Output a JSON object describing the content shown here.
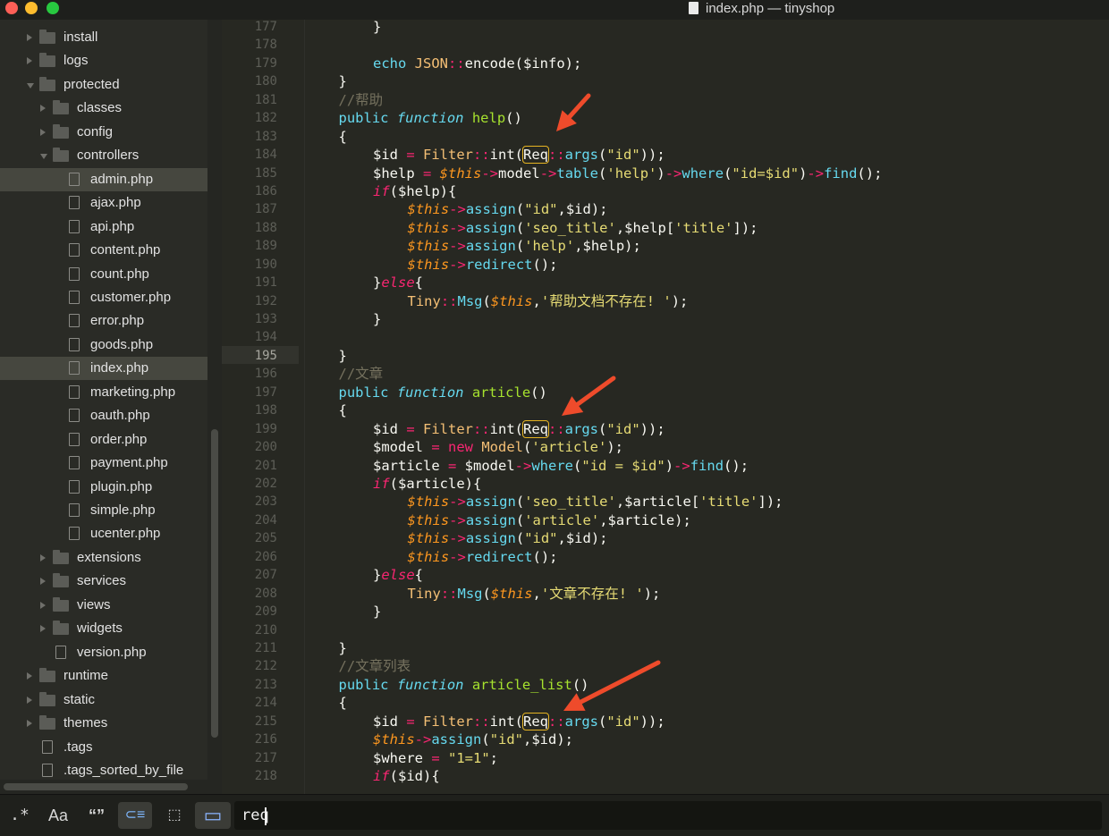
{
  "window": {
    "title": "index.php — tinyshop"
  },
  "sidebar": {
    "items": [
      {
        "label": "install",
        "type": "folder",
        "depth": 0,
        "open": false,
        "selected": false
      },
      {
        "label": "logs",
        "type": "folder",
        "depth": 0,
        "open": false,
        "selected": false
      },
      {
        "label": "protected",
        "type": "folder",
        "depth": 0,
        "open": true,
        "selected": false
      },
      {
        "label": "classes",
        "type": "folder",
        "depth": 1,
        "open": false,
        "selected": false
      },
      {
        "label": "config",
        "type": "folder",
        "depth": 1,
        "open": false,
        "selected": false
      },
      {
        "label": "controllers",
        "type": "folder",
        "depth": 1,
        "open": true,
        "selected": false
      },
      {
        "label": "admin.php",
        "type": "file",
        "depth": 2,
        "selected": true
      },
      {
        "label": "ajax.php",
        "type": "file",
        "depth": 2,
        "selected": false
      },
      {
        "label": "api.php",
        "type": "file",
        "depth": 2,
        "selected": false
      },
      {
        "label": "content.php",
        "type": "file",
        "depth": 2,
        "selected": false
      },
      {
        "label": "count.php",
        "type": "file",
        "depth": 2,
        "selected": false
      },
      {
        "label": "customer.php",
        "type": "file",
        "depth": 2,
        "selected": false
      },
      {
        "label": "error.php",
        "type": "file",
        "depth": 2,
        "selected": false
      },
      {
        "label": "goods.php",
        "type": "file",
        "depth": 2,
        "selected": false
      },
      {
        "label": "index.php",
        "type": "file",
        "depth": 2,
        "selected": true
      },
      {
        "label": "marketing.php",
        "type": "file",
        "depth": 2,
        "selected": false
      },
      {
        "label": "oauth.php",
        "type": "file",
        "depth": 2,
        "selected": false
      },
      {
        "label": "order.php",
        "type": "file",
        "depth": 2,
        "selected": false
      },
      {
        "label": "payment.php",
        "type": "file",
        "depth": 2,
        "selected": false
      },
      {
        "label": "plugin.php",
        "type": "file",
        "depth": 2,
        "selected": false
      },
      {
        "label": "simple.php",
        "type": "file",
        "depth": 2,
        "selected": false
      },
      {
        "label": "ucenter.php",
        "type": "file",
        "depth": 2,
        "selected": false
      },
      {
        "label": "extensions",
        "type": "folder",
        "depth": 1,
        "open": false,
        "selected": false
      },
      {
        "label": "services",
        "type": "folder",
        "depth": 1,
        "open": false,
        "selected": false
      },
      {
        "label": "views",
        "type": "folder",
        "depth": 1,
        "open": false,
        "selected": false
      },
      {
        "label": "widgets",
        "type": "folder",
        "depth": 1,
        "open": false,
        "selected": false
      },
      {
        "label": "version.php",
        "type": "file",
        "depth": 1,
        "selected": false
      },
      {
        "label": "runtime",
        "type": "folder",
        "depth": 0,
        "open": false,
        "selected": false
      },
      {
        "label": "static",
        "type": "folder",
        "depth": 0,
        "open": false,
        "selected": false
      },
      {
        "label": "themes",
        "type": "folder",
        "depth": 0,
        "open": false,
        "selected": false
      },
      {
        "label": ".tags",
        "type": "file",
        "depth": 0,
        "selected": false
      },
      {
        "label": ".tags_sorted_by_file",
        "type": "file",
        "depth": 0,
        "selected": false
      }
    ]
  },
  "editor": {
    "current_line": 195,
    "lines": [
      {
        "n": 177,
        "indent": 2,
        "tokens": [
          [
            "t",
            "}"
          ]
        ]
      },
      {
        "n": 178,
        "indent": 0,
        "tokens": []
      },
      {
        "n": 179,
        "indent": 2,
        "tokens": [
          [
            "k",
            "echo "
          ],
          [
            "y",
            "JSON"
          ],
          [
            "st",
            "::"
          ],
          [
            "t",
            "encode("
          ],
          [
            "t",
            "$info"
          ],
          [
            "t",
            ");"
          ]
        ]
      },
      {
        "n": 180,
        "indent": 1,
        "tokens": [
          [
            "t",
            "}"
          ]
        ]
      },
      {
        "n": 181,
        "indent": 1,
        "tokens": [
          [
            "c",
            "//帮助"
          ]
        ]
      },
      {
        "n": 182,
        "indent": 1,
        "tokens": [
          [
            "k",
            "public "
          ],
          [
            "m",
            "function "
          ],
          [
            "f",
            "help"
          ],
          [
            "t",
            "()"
          ]
        ]
      },
      {
        "n": 183,
        "indent": 1,
        "tokens": [
          [
            "t",
            "{"
          ]
        ]
      },
      {
        "n": 184,
        "indent": 2,
        "tokens": [
          [
            "t",
            "$id "
          ],
          [
            "st",
            "= "
          ],
          [
            "y",
            "Filter"
          ],
          [
            "st",
            "::"
          ],
          [
            "t",
            "int("
          ],
          [
            "hl",
            "Req"
          ],
          [
            "st",
            "::"
          ],
          [
            "k",
            "args"
          ],
          [
            "t",
            "("
          ],
          [
            "s",
            "\"id\""
          ],
          [
            "t",
            "));"
          ]
        ]
      },
      {
        "n": 185,
        "indent": 2,
        "tokens": [
          [
            "t",
            "$help "
          ],
          [
            "st",
            "= "
          ],
          [
            "v",
            "$this"
          ],
          [
            "st",
            "->"
          ],
          [
            "t",
            "model"
          ],
          [
            "st",
            "->"
          ],
          [
            "k",
            "table"
          ],
          [
            "t",
            "("
          ],
          [
            "s",
            "'help'"
          ],
          [
            "t",
            ")"
          ],
          [
            "st",
            "->"
          ],
          [
            "k",
            "where"
          ],
          [
            "t",
            "("
          ],
          [
            "s",
            "\"id=$id\""
          ],
          [
            "t",
            ")"
          ],
          [
            "st",
            "->"
          ],
          [
            "k",
            "find"
          ],
          [
            "t",
            "();"
          ]
        ]
      },
      {
        "n": 186,
        "indent": 2,
        "tokens": [
          [
            "sp",
            "if"
          ],
          [
            "t",
            "($help){"
          ]
        ]
      },
      {
        "n": 187,
        "indent": 3,
        "tokens": [
          [
            "v",
            "$this"
          ],
          [
            "st",
            "->"
          ],
          [
            "k",
            "assign"
          ],
          [
            "t",
            "("
          ],
          [
            "s",
            "\"id\""
          ],
          [
            "t",
            ",$id);"
          ]
        ]
      },
      {
        "n": 188,
        "indent": 3,
        "tokens": [
          [
            "v",
            "$this"
          ],
          [
            "st",
            "->"
          ],
          [
            "k",
            "assign"
          ],
          [
            "t",
            "("
          ],
          [
            "s",
            "'seo_title'"
          ],
          [
            "t",
            ",$help["
          ],
          [
            "s",
            "'title'"
          ],
          [
            "t",
            "]);"
          ]
        ]
      },
      {
        "n": 189,
        "indent": 3,
        "tokens": [
          [
            "v",
            "$this"
          ],
          [
            "st",
            "->"
          ],
          [
            "k",
            "assign"
          ],
          [
            "t",
            "("
          ],
          [
            "s",
            "'help'"
          ],
          [
            "t",
            ",$help);"
          ]
        ]
      },
      {
        "n": 190,
        "indent": 3,
        "tokens": [
          [
            "v",
            "$this"
          ],
          [
            "st",
            "->"
          ],
          [
            "k",
            "redirect"
          ],
          [
            "t",
            "();"
          ]
        ]
      },
      {
        "n": 191,
        "indent": 2,
        "tokens": [
          [
            "t",
            "}"
          ],
          [
            "sp",
            "else"
          ],
          [
            "t",
            "{"
          ]
        ]
      },
      {
        "n": 192,
        "indent": 3,
        "tokens": [
          [
            "y",
            "Tiny"
          ],
          [
            "st",
            "::"
          ],
          [
            "k",
            "Msg"
          ],
          [
            "t",
            "("
          ],
          [
            "v",
            "$this"
          ],
          [
            "t",
            ","
          ],
          [
            "s",
            "'帮助文档不存在! '"
          ],
          [
            "t",
            ");"
          ]
        ]
      },
      {
        "n": 193,
        "indent": 2,
        "tokens": [
          [
            "t",
            "}"
          ]
        ]
      },
      {
        "n": 194,
        "indent": 0,
        "tokens": []
      },
      {
        "n": 195,
        "indent": 1,
        "tokens": [
          [
            "t",
            "}"
          ]
        ]
      },
      {
        "n": 196,
        "indent": 1,
        "tokens": [
          [
            "c",
            "//文章"
          ]
        ]
      },
      {
        "n": 197,
        "indent": 1,
        "tokens": [
          [
            "k",
            "public "
          ],
          [
            "m",
            "function "
          ],
          [
            "f",
            "article"
          ],
          [
            "t",
            "()"
          ]
        ]
      },
      {
        "n": 198,
        "indent": 1,
        "tokens": [
          [
            "t",
            "{"
          ]
        ]
      },
      {
        "n": 199,
        "indent": 2,
        "tokens": [
          [
            "t",
            "$id "
          ],
          [
            "st",
            "= "
          ],
          [
            "y",
            "Filter"
          ],
          [
            "st",
            "::"
          ],
          [
            "t",
            "int("
          ],
          [
            "hl",
            "Req"
          ],
          [
            "st",
            "::"
          ],
          [
            "k",
            "args"
          ],
          [
            "t",
            "("
          ],
          [
            "s",
            "\"id\""
          ],
          [
            "t",
            "));"
          ]
        ]
      },
      {
        "n": 200,
        "indent": 2,
        "tokens": [
          [
            "t",
            "$model "
          ],
          [
            "st",
            "= "
          ],
          [
            "st",
            "new "
          ],
          [
            "y",
            "Model"
          ],
          [
            "t",
            "("
          ],
          [
            "s",
            "'article'"
          ],
          [
            "t",
            ");"
          ]
        ]
      },
      {
        "n": 201,
        "indent": 2,
        "tokens": [
          [
            "t",
            "$article "
          ],
          [
            "st",
            "= "
          ],
          [
            "t",
            "$model"
          ],
          [
            "st",
            "->"
          ],
          [
            "k",
            "where"
          ],
          [
            "t",
            "("
          ],
          [
            "s",
            "\"id = $id\""
          ],
          [
            "t",
            ")"
          ],
          [
            "st",
            "->"
          ],
          [
            "k",
            "find"
          ],
          [
            "t",
            "();"
          ]
        ]
      },
      {
        "n": 202,
        "indent": 2,
        "tokens": [
          [
            "sp",
            "if"
          ],
          [
            "t",
            "($article){"
          ]
        ]
      },
      {
        "n": 203,
        "indent": 3,
        "tokens": [
          [
            "v",
            "$this"
          ],
          [
            "st",
            "->"
          ],
          [
            "k",
            "assign"
          ],
          [
            "t",
            "("
          ],
          [
            "s",
            "'seo_title'"
          ],
          [
            "t",
            ",$article["
          ],
          [
            "s",
            "'title'"
          ],
          [
            "t",
            "]);"
          ]
        ]
      },
      {
        "n": 204,
        "indent": 3,
        "tokens": [
          [
            "v",
            "$this"
          ],
          [
            "st",
            "->"
          ],
          [
            "k",
            "assign"
          ],
          [
            "t",
            "("
          ],
          [
            "s",
            "'article'"
          ],
          [
            "t",
            ",$article);"
          ]
        ]
      },
      {
        "n": 205,
        "indent": 3,
        "tokens": [
          [
            "v",
            "$this"
          ],
          [
            "st",
            "->"
          ],
          [
            "k",
            "assign"
          ],
          [
            "t",
            "("
          ],
          [
            "s",
            "\"id\""
          ],
          [
            "t",
            ",$id);"
          ]
        ]
      },
      {
        "n": 206,
        "indent": 3,
        "tokens": [
          [
            "v",
            "$this"
          ],
          [
            "st",
            "->"
          ],
          [
            "k",
            "redirect"
          ],
          [
            "t",
            "();"
          ]
        ]
      },
      {
        "n": 207,
        "indent": 2,
        "tokens": [
          [
            "t",
            "}"
          ],
          [
            "sp",
            "else"
          ],
          [
            "t",
            "{"
          ]
        ]
      },
      {
        "n": 208,
        "indent": 3,
        "tokens": [
          [
            "y",
            "Tiny"
          ],
          [
            "st",
            "::"
          ],
          [
            "k",
            "Msg"
          ],
          [
            "t",
            "("
          ],
          [
            "v",
            "$this"
          ],
          [
            "t",
            ","
          ],
          [
            "s",
            "'文章不存在! '"
          ],
          [
            "t",
            ");"
          ]
        ]
      },
      {
        "n": 209,
        "indent": 2,
        "tokens": [
          [
            "t",
            "}"
          ]
        ]
      },
      {
        "n": 210,
        "indent": 0,
        "tokens": []
      },
      {
        "n": 211,
        "indent": 1,
        "tokens": [
          [
            "t",
            "}"
          ]
        ]
      },
      {
        "n": 212,
        "indent": 1,
        "tokens": [
          [
            "c",
            "//文章列表"
          ]
        ]
      },
      {
        "n": 213,
        "indent": 1,
        "tokens": [
          [
            "k",
            "public "
          ],
          [
            "m",
            "function "
          ],
          [
            "f",
            "article_list"
          ],
          [
            "t",
            "()"
          ]
        ]
      },
      {
        "n": 214,
        "indent": 1,
        "tokens": [
          [
            "t",
            "{"
          ]
        ]
      },
      {
        "n": 215,
        "indent": 2,
        "tokens": [
          [
            "t",
            "$id "
          ],
          [
            "st",
            "= "
          ],
          [
            "y",
            "Filter"
          ],
          [
            "st",
            "::"
          ],
          [
            "t",
            "int("
          ],
          [
            "hl",
            "Req"
          ],
          [
            "st",
            "::"
          ],
          [
            "k",
            "args"
          ],
          [
            "t",
            "("
          ],
          [
            "s",
            "\"id\""
          ],
          [
            "t",
            "));"
          ]
        ]
      },
      {
        "n": 216,
        "indent": 2,
        "tokens": [
          [
            "v",
            "$this"
          ],
          [
            "st",
            "->"
          ],
          [
            "k",
            "assign"
          ],
          [
            "t",
            "("
          ],
          [
            "s",
            "\"id\""
          ],
          [
            "t",
            ",$id);"
          ]
        ]
      },
      {
        "n": 217,
        "indent": 2,
        "tokens": [
          [
            "t",
            "$where "
          ],
          [
            "st",
            "= "
          ],
          [
            "s",
            "\"1=1\""
          ],
          [
            "t",
            ";"
          ]
        ]
      },
      {
        "n": 218,
        "indent": 2,
        "tokens": [
          [
            "sp",
            "if"
          ],
          [
            "t",
            "($id){"
          ]
        ]
      }
    ]
  },
  "annotations": {
    "arrow_color": "#ee4b2b"
  },
  "findbar": {
    "regex_label": ".*",
    "case_label": "Aa",
    "word_label": "“”",
    "wrap_label": "⊂≡",
    "selection_label": "⬚",
    "highlight_label": "▭",
    "query": "req"
  }
}
